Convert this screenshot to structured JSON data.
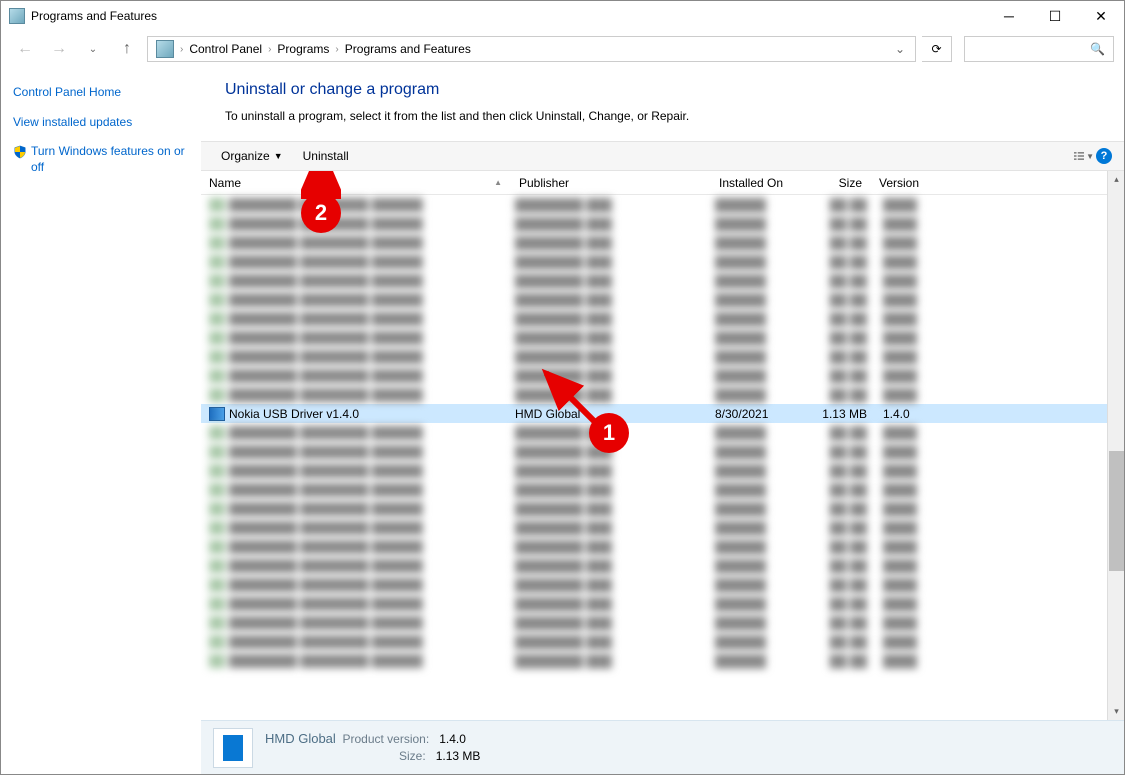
{
  "window": {
    "title": "Programs and Features"
  },
  "breadcrumbs": [
    "Control Panel",
    "Programs",
    "Programs and Features"
  ],
  "sidebar": {
    "home": "Control Panel Home",
    "updates": "View installed updates",
    "features": "Turn Windows features on or off"
  },
  "header": {
    "title": "Uninstall or change a program",
    "desc": "To uninstall a program, select it from the list and then click Uninstall, Change, or Repair."
  },
  "toolbar": {
    "organize": "Organize",
    "uninstall": "Uninstall"
  },
  "columns": {
    "name": "Name",
    "publisher": "Publisher",
    "installed_on": "Installed On",
    "size": "Size",
    "version": "Version"
  },
  "selected": {
    "name": "Nokia USB Driver v1.4.0",
    "publisher": "HMD Global",
    "installed_on": "8/30/2021",
    "size": "1.13 MB",
    "version": "1.4.0"
  },
  "details": {
    "publisher": "HMD Global",
    "product_version_label": "Product version:",
    "product_version": "1.4.0",
    "size_label": "Size:",
    "size": "1.13 MB"
  },
  "annotations": {
    "marker1": "1",
    "marker2": "2"
  }
}
